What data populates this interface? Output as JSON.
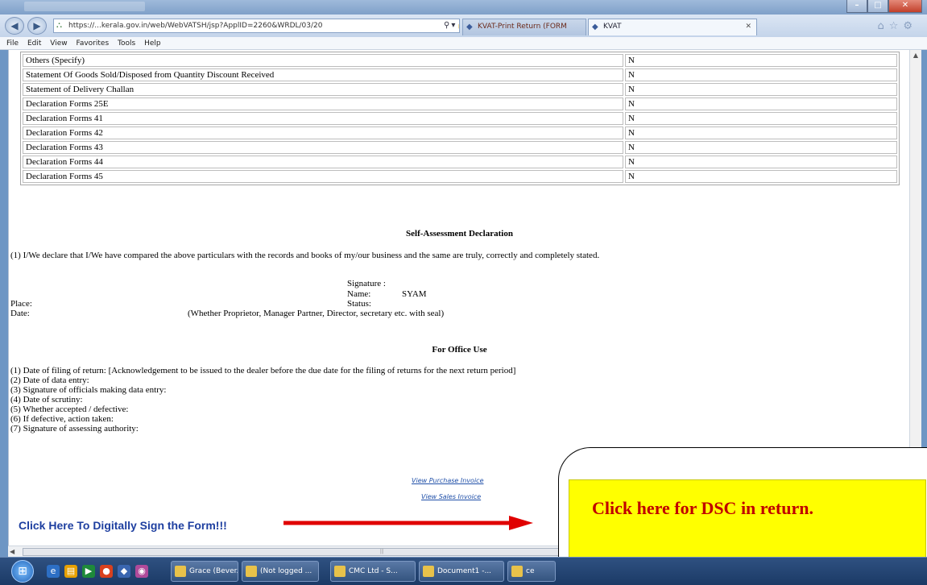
{
  "browser": {
    "address": "https://...kerala.gov.in/web/WebVATSH/jsp?ApplID=2260&WRDL/03/20",
    "tabs": [
      {
        "label": "KVAT-Print Return (FORM"
      },
      {
        "label": "KVAT"
      }
    ],
    "menu": [
      "File",
      "Edit",
      "View",
      "Favorites",
      "Tools",
      "Help"
    ]
  },
  "declarations": {
    "rows": [
      {
        "label": "Others (Specify)",
        "value": "N"
      },
      {
        "label": "Statement Of Goods Sold/Disposed from Quantity Discount Received",
        "value": "N"
      },
      {
        "label": "Statement of Delivery Challan",
        "value": "N"
      },
      {
        "label": "Declaration Forms 25E",
        "value": "N"
      },
      {
        "label": "Declaration Forms 41",
        "value": "N"
      },
      {
        "label": "Declaration Forms 42",
        "value": "N"
      },
      {
        "label": "Declaration Forms 43",
        "value": "N"
      },
      {
        "label": "Declaration Forms 44",
        "value": "N"
      },
      {
        "label": "Declaration Forms 45",
        "value": "N"
      }
    ]
  },
  "self_assessment": {
    "heading": "Self-Assessment Declaration",
    "statement": "(1) I/We declare that I/We have compared the above particulars with the records and books of my/our business and the same are truly, correctly and completely stated.",
    "signature_label": "Signature :",
    "name_label": "Name:",
    "name_value": "SYAM",
    "status_label": "Status:",
    "place_label": "Place:",
    "date_label": "Date:",
    "status_note": "(Whether Proprietor, Manager Partner, Director, secretary etc. with seal)"
  },
  "office_use": {
    "heading": "For Office Use",
    "items": [
      "(1) Date of filing of return: [Acknowledgement to be issued to the dealer before the due date for the filing of returns for the next return period]",
      "(2) Date of data entry:",
      "(3) Signature of officials making data entry:",
      "(4) Date of scrutiny:",
      "(5) Whether accepted / defective:",
      "(6) If defective, action taken:",
      "(7) Signature of assessing authority:"
    ]
  },
  "links": {
    "purchase_invoice": "View Purchase Invoice",
    "sales_invoice": "View Sales Invoice",
    "digital_sign": "Click Here To Digitally Sign the Form!!!"
  },
  "callout": {
    "text": "Click here for DSC in return."
  },
  "taskbar": {
    "items": [
      "Grace (Bever...",
      "(Not logged ...",
      "CMC Ltd - S...",
      "Document1 -...",
      "ce"
    ]
  }
}
